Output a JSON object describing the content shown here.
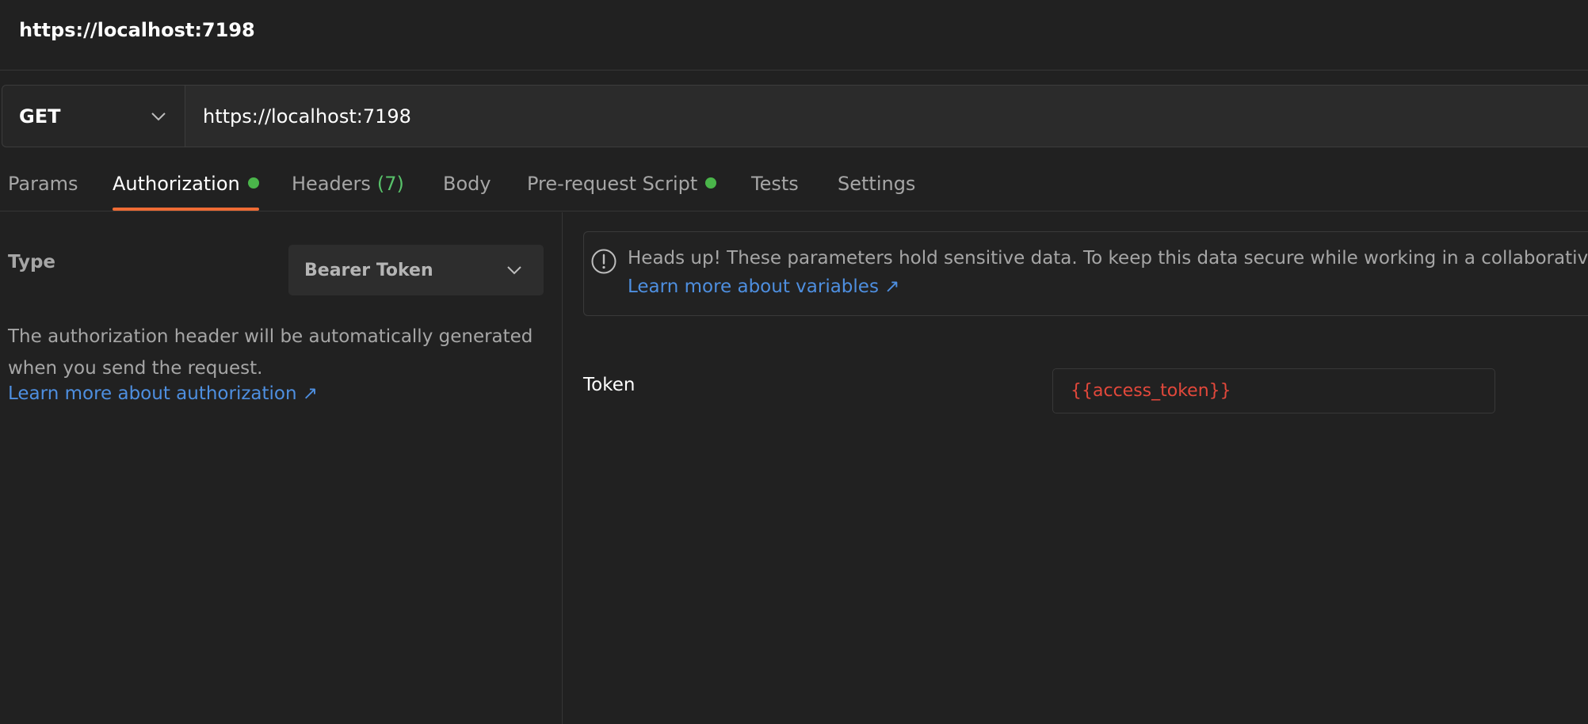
{
  "window": {
    "title": "https://localhost:7198"
  },
  "request": {
    "method": "GET",
    "url": "https://localhost:7198"
  },
  "tabs": [
    {
      "label": "Params",
      "active": false
    },
    {
      "label": "Authorization",
      "active": true,
      "indicator": true
    },
    {
      "label": "Headers",
      "count": "(7)",
      "active": false
    },
    {
      "label": "Body",
      "active": false
    },
    {
      "label": "Pre-request Script",
      "active": false,
      "indicator": true
    },
    {
      "label": "Tests",
      "active": false
    },
    {
      "label": "Settings",
      "active": false
    }
  ],
  "auth": {
    "type_label": "Type",
    "type_value": "Bearer Token",
    "description": "The authorization header will be automatically generated when you send the request.",
    "learn_more": "Learn more about authorization ↗"
  },
  "notice": {
    "message": "Heads up! These parameters hold sensitive data. To keep this data secure while working in a collaborative environment, we recommend using variables.",
    "learn_more": "Learn more about variables ↗"
  },
  "token": {
    "label": "Token",
    "value": "{{access_token}}"
  },
  "colors": {
    "accent": "#ef6c35",
    "indicator": "#4ab54a",
    "link": "#4e8fe0",
    "variable_unresolved": "#e2483b",
    "background": "#212121"
  }
}
